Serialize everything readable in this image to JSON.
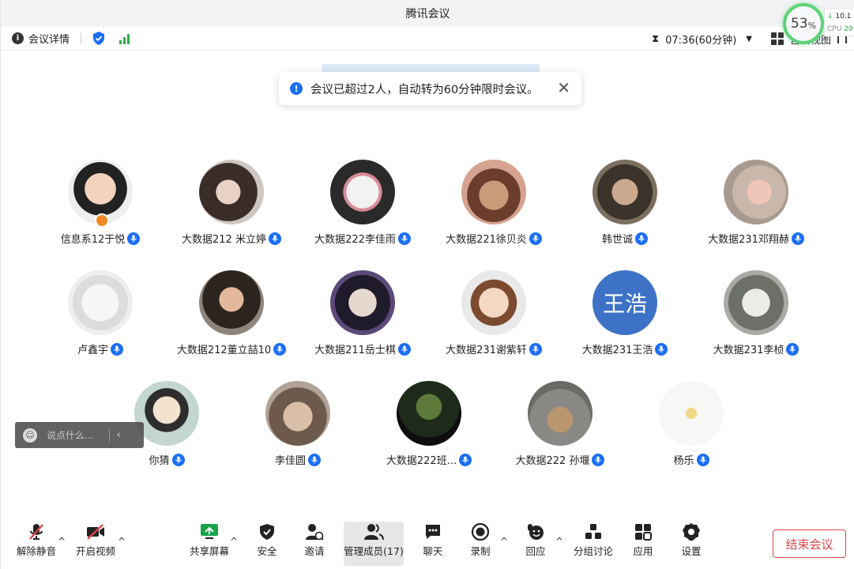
{
  "window": {
    "title": "腾讯会议"
  },
  "infobar": {
    "meeting_details": "会议详情",
    "timer": "07:36(60分钟)",
    "view_mode": "宫格视图"
  },
  "cpu": {
    "percent": "53",
    "percent_unit": "%",
    "net": "10.1",
    "cpu_label": "CPU",
    "cpu_value": "29"
  },
  "toast": {
    "message": "会议已超过2人，自动转为60分钟限时会议。"
  },
  "participants": [
    {
      "name": "信息系12于悦"
    },
    {
      "name": "大数据212 米立婷"
    },
    {
      "name": "大数据222李佳雨"
    },
    {
      "name": "大数据221徐贝炎"
    },
    {
      "name": "韩世诚"
    },
    {
      "name": "大数据231邓翔赫"
    },
    {
      "name": "卢鑫宇"
    },
    {
      "name": "大数据212董立喆10"
    },
    {
      "name": "大数据211岳士棋"
    },
    {
      "name": "大数据231谢紫轩"
    },
    {
      "name": "大数据231王浩",
      "avatar_text": "王浩"
    },
    {
      "name": "大数据231李桢"
    },
    {
      "name": "你猜"
    },
    {
      "name": "李佳圆"
    },
    {
      "name": "大数据222班..."
    },
    {
      "name": "大数据222 孙堰"
    },
    {
      "name": "杨乐"
    }
  ],
  "chat": {
    "placeholder": "说点什么..."
  },
  "toolbar": {
    "unmute": "解除静音",
    "start_video": "开启视频",
    "share_screen": "共享屏幕",
    "security": "安全",
    "invite": "邀请",
    "manage_members": "管理成员(17)",
    "chat": "聊天",
    "record": "录制",
    "reaction": "回应",
    "breakout": "分组讨论",
    "apps": "应用",
    "settings": "设置",
    "end_meeting": "结束会议"
  },
  "colors": {
    "accent": "#1a6ef5",
    "signal": "#2bb14a",
    "danger": "#e0464a",
    "host": "#f08a24"
  }
}
